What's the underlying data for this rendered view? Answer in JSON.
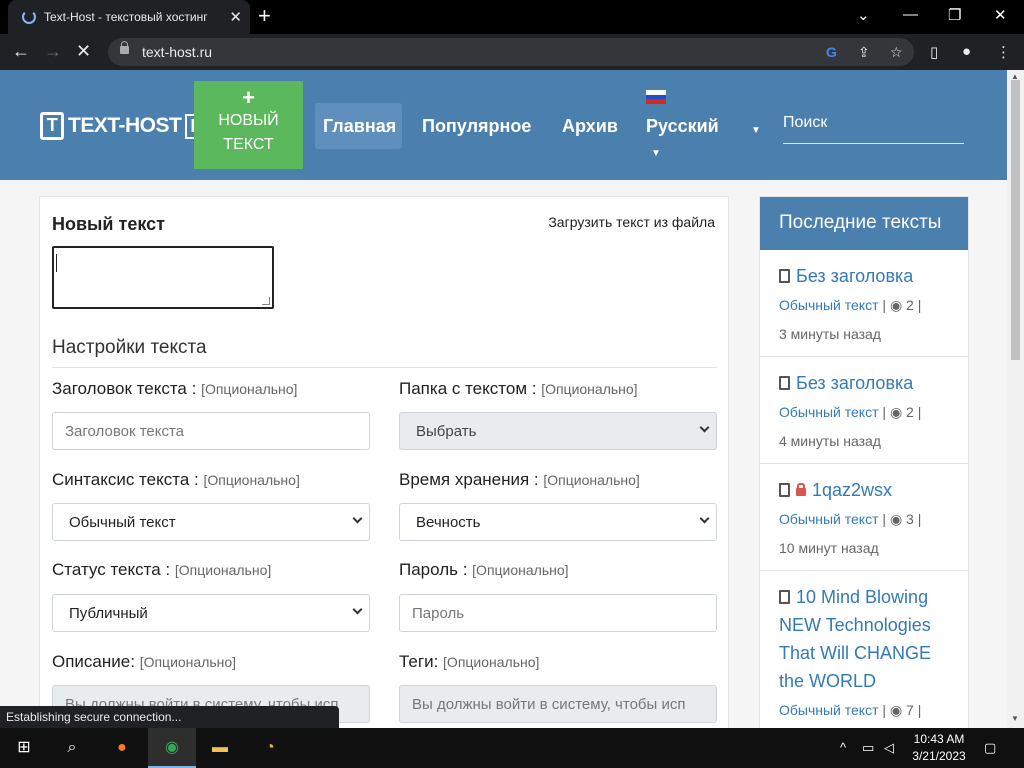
{
  "browser": {
    "tab_title": "Text-Host - текстовый хостинг",
    "tab_close": "✕",
    "new_tab": "+",
    "url": "text-host.ru",
    "status_text": "Establishing secure connection..."
  },
  "site": {
    "logo_text": "TEXT-HOST",
    "logo_suffix": "RU",
    "new_button_plus": "+",
    "new_button_line1": "НОВЫЙ",
    "new_button_line2": "ТЕКСТ",
    "nav": {
      "home": "Главная",
      "popular": "Популярное",
      "archive": "Архив",
      "language": "Русский"
    },
    "search_placeholder": "Поиск",
    "flag_colors": [
      "#ffffff",
      "#1e50c8",
      "#d52b1e"
    ]
  },
  "form": {
    "title": "Новый текст",
    "upload_link": "Загрузить текст из файла",
    "settings_title": "Настройки текста",
    "optional": "[Опционально]",
    "title_label": "Заголовок текста :",
    "title_placeholder": "Заголовок текста",
    "folder_label": "Папка с текстом :",
    "folder_value": "Выбрать",
    "syntax_label": "Синтаксис текста :",
    "syntax_value": "Обычный текст",
    "expiry_label": "Время хранения :",
    "expiry_value": "Вечность",
    "status_label": "Статус текста :",
    "status_value": "Публичный",
    "password_label": "Пароль :",
    "password_placeholder": "Пароль",
    "description_label": "Описание:",
    "description_placeholder": "Вы должны войти в систему, чтобы исп",
    "tags_label": "Теги:",
    "tags_placeholder": "Вы должны войти в систему, чтобы исп"
  },
  "sidebar": {
    "title": "Последние тексты",
    "items": [
      {
        "title": "Без заголовка",
        "type": "Обычный текст",
        "views": "2",
        "time": "3 минуты назад",
        "locked": false
      },
      {
        "title": "Без заголовка",
        "type": "Обычный текст",
        "views": "2",
        "time": "4 минуты назад",
        "locked": false
      },
      {
        "title": "1qaz2wsx",
        "type": "Обычный текст",
        "views": "3",
        "time": "10 минут назад",
        "locked": true
      },
      {
        "title": "10 Mind Blowing NEW Technologies That Will CHANGE the WORLD",
        "type": "Обычный текст",
        "views": "7",
        "time": "",
        "locked": false
      }
    ]
  },
  "taskbar": {
    "time": "10:43 AM",
    "date": "3/21/2023"
  }
}
